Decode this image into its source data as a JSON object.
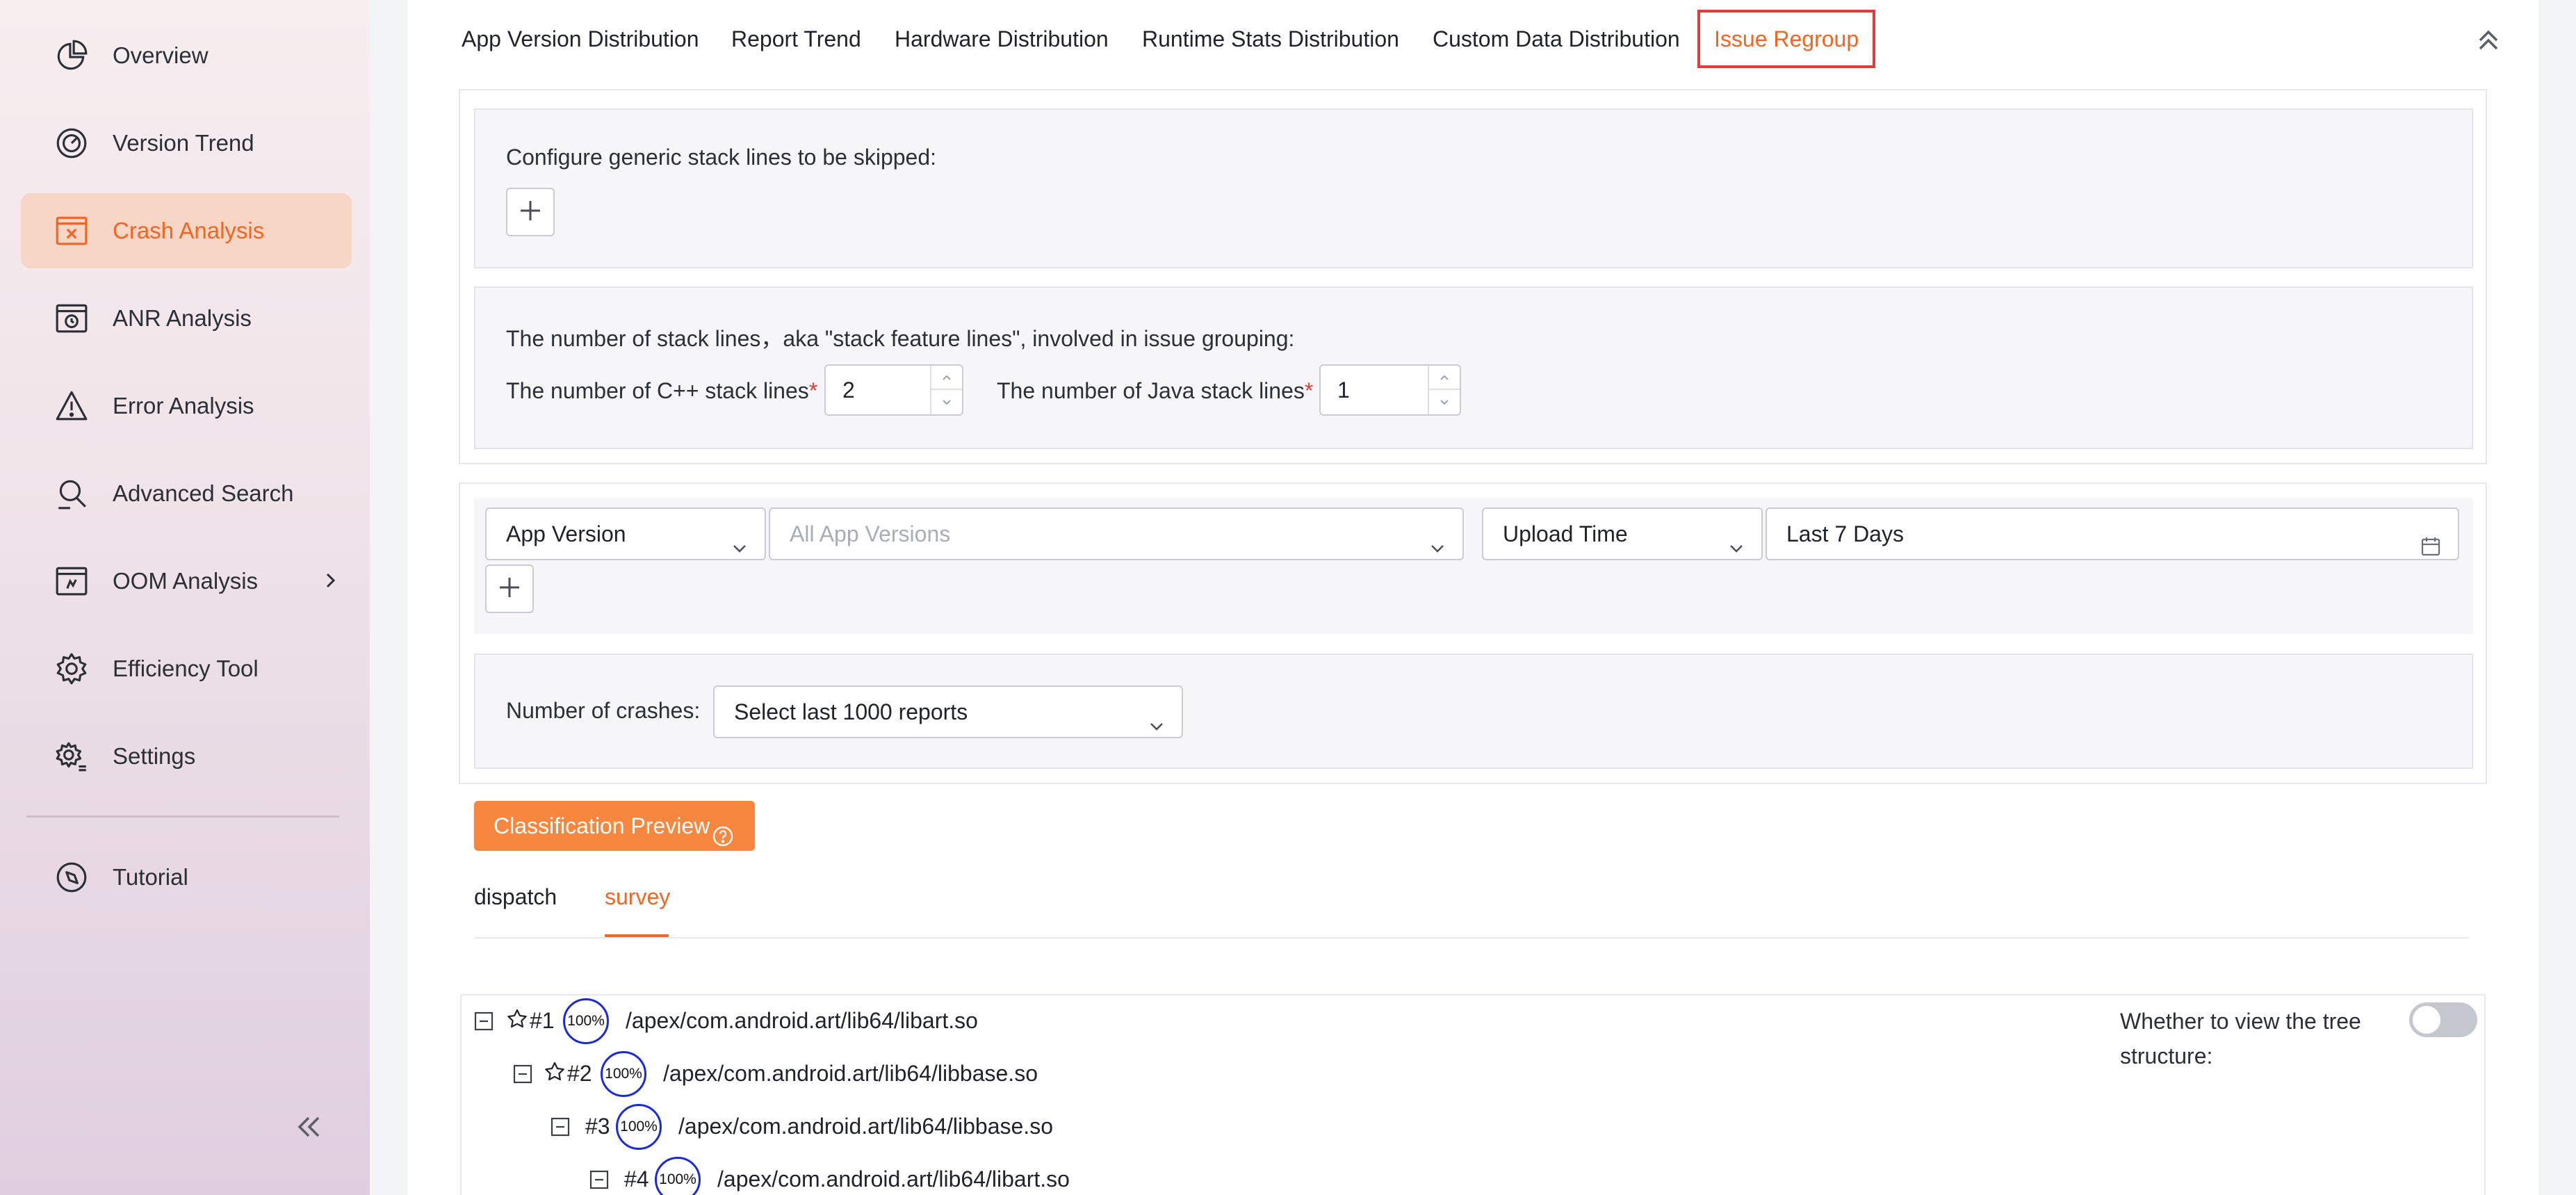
{
  "sidebar": {
    "items": [
      {
        "label": "Overview",
        "icon": "pie-chart-icon"
      },
      {
        "label": "Version Trend",
        "icon": "gauge-icon"
      },
      {
        "label": "Crash Analysis",
        "icon": "crash-window-icon",
        "active": true
      },
      {
        "label": "ANR Analysis",
        "icon": "anr-window-icon"
      },
      {
        "label": "Error Analysis",
        "icon": "warning-icon"
      },
      {
        "label": "Advanced Search",
        "icon": "search-icon"
      },
      {
        "label": "OOM Analysis",
        "icon": "oom-window-icon",
        "has_children": true
      },
      {
        "label": "Efficiency Tool",
        "icon": "gear-icon"
      },
      {
        "label": "Settings",
        "icon": "settings-icon"
      },
      {
        "label": "Tutorial",
        "icon": "compass-icon"
      }
    ],
    "collapse_icon": "double-chevron-left-icon"
  },
  "tabs": [
    {
      "label": "App Version Distribution"
    },
    {
      "label": "Report Trend"
    },
    {
      "label": "Hardware Distribution"
    },
    {
      "label": "Runtime Stats Distribution"
    },
    {
      "label": "Custom Data Distribution"
    },
    {
      "label": "Issue Regroup",
      "active": true
    }
  ],
  "skip_config": {
    "label": "Configure generic stack lines to be skipped:"
  },
  "stack_lines": {
    "heading": "The number of stack lines，aka \"stack feature lines\", involved in issue grouping:",
    "cpp_label": "The number of C++ stack lines",
    "cpp_value": "2",
    "java_label": "The number of Java stack lines",
    "java_value": "1",
    "required_mark": "*"
  },
  "filters": {
    "field1": "App Version",
    "field1_value_placeholder": "All App Versions",
    "field2": "Upload Time",
    "field2_value": "Last 7 Days"
  },
  "crashes": {
    "label": "Number of crashes:",
    "value": "Select last 1000 reports"
  },
  "preview_button": "Classification Preview",
  "subtabs": [
    {
      "label": "dispatch"
    },
    {
      "label": "survey",
      "active": true
    }
  ],
  "tree": {
    "switch_label": "Whether to view the tree structure:",
    "switch_on": false,
    "rows": [
      {
        "index": "#1",
        "starred": true,
        "percent": "100%",
        "path": "/apex/com.android.art/lib64/libart.so"
      },
      {
        "index": "#2",
        "starred": true,
        "percent": "100%",
        "path": "/apex/com.android.art/lib64/libbase.so"
      },
      {
        "index": "#3",
        "starred": false,
        "percent": "100%",
        "path": "/apex/com.android.art/lib64/libbase.so"
      },
      {
        "index": "#4",
        "starred": false,
        "percent": "100%",
        "path": "/apex/com.android.art/lib64/libart.so"
      }
    ]
  },
  "colors": {
    "accent": "#f26522",
    "primary_button": "#f7863f",
    "highlight_border": "#e23b3b",
    "percent_circle": "#1a2bd6"
  }
}
